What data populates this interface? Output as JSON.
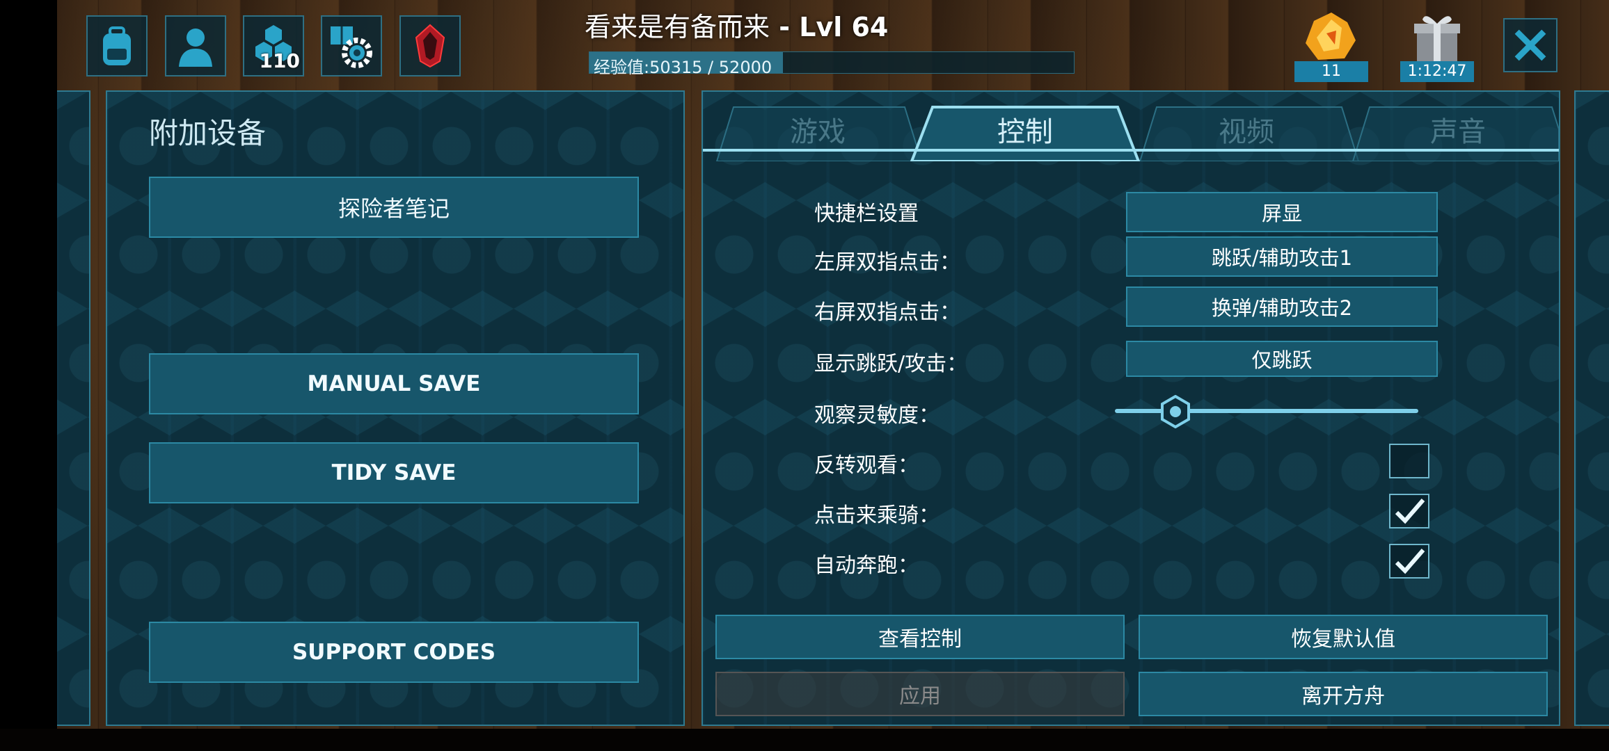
{
  "header": {
    "title": "看来是有备而来",
    "level": " - Lvl 64",
    "xp_label": "经验值:50315 / 52000",
    "xp_progress": 0.4,
    "engrams_badge": "110",
    "element_count": "11",
    "gift_timer": "1:12:47"
  },
  "left_panel": {
    "title": "附加设备",
    "explorer_notes": "探险者笔记",
    "manual_save": "MANUAL SAVE",
    "tidy_save": "TIDY SAVE",
    "support_codes": "SUPPORT CODES"
  },
  "tabs": [
    {
      "label": "游戏",
      "active": false
    },
    {
      "label": "控制",
      "active": true
    },
    {
      "label": "视频",
      "active": false
    },
    {
      "label": "声音",
      "active": false
    }
  ],
  "settings": {
    "hotbar_label": "快捷栏设置",
    "hotbar_value": "屏显",
    "left_double_tap_label": "左屏双指点击：",
    "left_double_tap_value": "跳跃/辅助攻击1",
    "right_double_tap_label": "右屏双指点击：",
    "right_double_tap_value": "换弹/辅助攻击2",
    "show_jump_attack_label": "显示跳跃/攻击：",
    "show_jump_attack_value": "仅跳跃",
    "look_sensitivity_label": "观察灵敏度：",
    "look_sensitivity_value": 0.2,
    "invert_look_label": "反转观看：",
    "invert_look_checked": false,
    "tap_to_ride_label": "点击来乘骑：",
    "tap_to_ride_checked": true,
    "auto_run_label": "自动奔跑：",
    "auto_run_checked": true
  },
  "actions": {
    "view_controls": "查看控制",
    "restore_defaults": "恢复默认值",
    "apply": "应用",
    "leave_ark": "离开方舟"
  },
  "colors": {
    "accent": "#2c89a4",
    "button": "#17566b",
    "panel": "#0d2f3c"
  }
}
